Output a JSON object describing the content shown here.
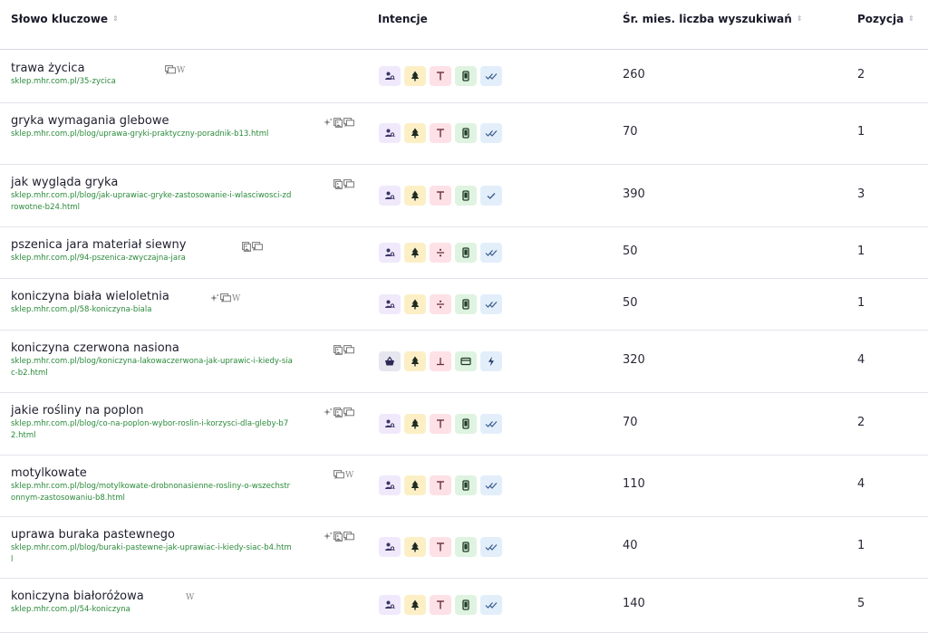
{
  "header": {
    "keyword": "Słowo kluczowe",
    "intent": "Intencje",
    "volume": "Śr. mies. liczba wyszukiwań",
    "position": "Pozycja"
  },
  "sort_glyph": "⇕",
  "colors": {
    "url_green": "#2a8a3a",
    "chip_purple": "#efe9fb",
    "chip_yellow": "#fdefc5",
    "chip_pink": "#fde1e6",
    "chip_green": "#dff3e1",
    "chip_blue": "#e3eefb",
    "chip_navy": "#e6e6ef"
  },
  "rows": [
    {
      "keyword": "trawa życica",
      "url": "sklep.mhr.com.pl/35-zycica",
      "features": [
        "reviews-icon",
        "wikipedia-icon"
      ],
      "intents": [
        "people-icon",
        "tree-icon",
        "text-icon",
        "mobile-icon",
        "double-check-icon"
      ],
      "volume": "260",
      "position": "2"
    },
    {
      "keyword": "gryka wymagania glebowe",
      "url": "sklep.mhr.com.pl/blog/uprawa-gryki-praktyczny-poradnik-b13.html",
      "features": [
        "ai-overview-icon",
        "image-icon",
        "reviews-icon"
      ],
      "intents": [
        "people-icon",
        "tree-icon",
        "text-icon",
        "mobile-icon",
        "double-check-icon"
      ],
      "volume": "70",
      "position": "1"
    },
    {
      "keyword": "jak wygląda gryka",
      "url": "sklep.mhr.com.pl/blog/jak-uprawiac-gryke-zastosowanie-i-wlasciwosci-zdrowotne-b24.html",
      "features": [
        "image-icon",
        "reviews-icon"
      ],
      "intents": [
        "people-icon",
        "tree-icon",
        "text-icon",
        "mobile-icon",
        "check-icon"
      ],
      "volume": "390",
      "position": "3"
    },
    {
      "keyword": "pszenica jara materiał siewny",
      "url": "sklep.mhr.com.pl/94-pszenica-zwyczajna-jara",
      "features": [
        "image-icon",
        "reviews-icon"
      ],
      "intents": [
        "people-icon",
        "tree-icon",
        "divide-icon",
        "mobile-icon",
        "double-check-icon"
      ],
      "volume": "50",
      "position": "1"
    },
    {
      "keyword": "koniczyna biała wieloletnia",
      "url": "sklep.mhr.com.pl/58-koniczyna-biala",
      "features": [
        "ai-overview-icon",
        "reviews-icon",
        "wikipedia-icon"
      ],
      "intents": [
        "people-icon",
        "tree-icon",
        "divide-icon",
        "mobile-icon",
        "double-check-icon"
      ],
      "volume": "50",
      "position": "1"
    },
    {
      "keyword": "koniczyna czerwona nasiona",
      "url": "sklep.mhr.com.pl/blog/koniczyna-lakowaczerwona-jak-uprawic-i-kiedy-siac-b2.html",
      "features": [
        "image-icon",
        "reviews-icon"
      ],
      "intents": [
        "basket-icon",
        "tree-icon",
        "bottom-icon",
        "card-icon",
        "bolt-icon"
      ],
      "volume": "320",
      "position": "4"
    },
    {
      "keyword": "jakie rośliny na poplon",
      "url": "sklep.mhr.com.pl/blog/co-na-poplon-wybor-roslin-i-korzysci-dla-gleby-b72.html",
      "features": [
        "ai-overview-icon",
        "image-icon",
        "reviews-icon"
      ],
      "intents": [
        "people-icon",
        "tree-icon",
        "text-icon",
        "mobile-icon",
        "double-check-icon"
      ],
      "volume": "70",
      "position": "2"
    },
    {
      "keyword": "motylkowate",
      "url": "sklep.mhr.com.pl/blog/motylkowate-drobnonasienne-rosliny-o-wszechstronnym-zastosowaniu-b8.html",
      "features": [
        "reviews-icon",
        "wikipedia-icon"
      ],
      "intents": [
        "people-icon",
        "tree-icon",
        "text-icon",
        "mobile-icon",
        "double-check-icon"
      ],
      "volume": "110",
      "position": "4"
    },
    {
      "keyword": "uprawa buraka pastewnego",
      "url": "sklep.mhr.com.pl/blog/buraki-pastewne-jak-uprawiac-i-kiedy-siac-b4.html",
      "features": [
        "ai-overview-icon",
        "image-icon",
        "reviews-icon"
      ],
      "intents": [
        "people-icon",
        "tree-icon",
        "text-icon",
        "mobile-icon",
        "double-check-icon"
      ],
      "volume": "40",
      "position": "1"
    },
    {
      "keyword": "koniczyna białoróżowa",
      "url": "sklep.mhr.com.pl/54-koniczyna",
      "features": [
        "wikipedia-icon"
      ],
      "intents": [
        "people-icon",
        "tree-icon",
        "text-icon",
        "mobile-icon",
        "double-check-icon"
      ],
      "volume": "140",
      "position": "5"
    }
  ]
}
